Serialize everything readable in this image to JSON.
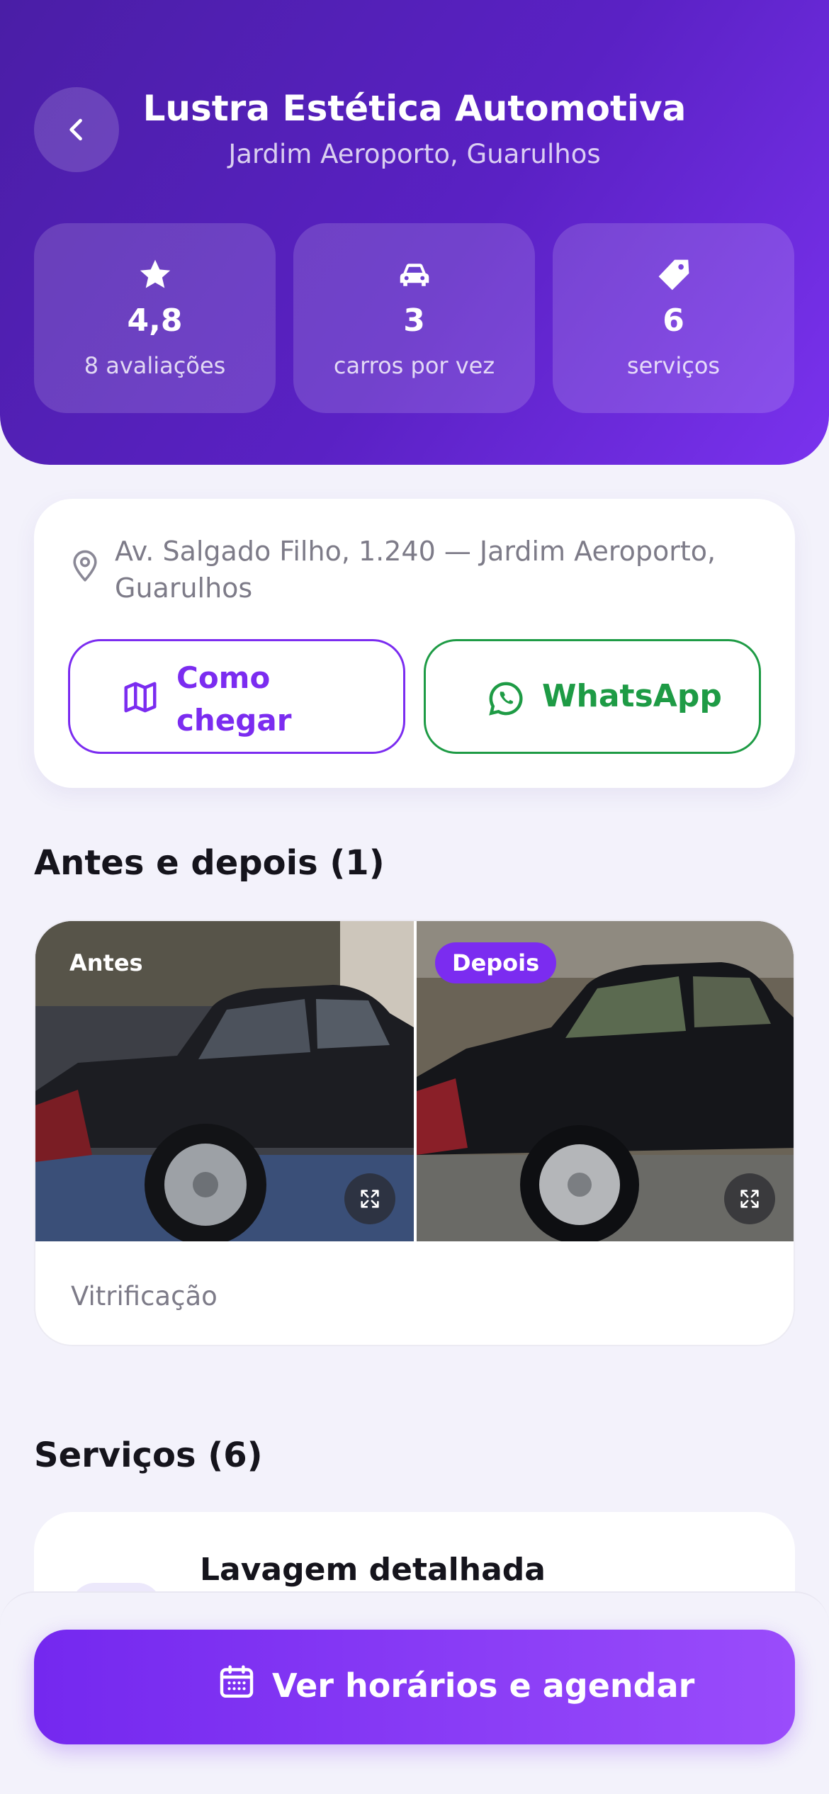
{
  "header": {
    "back_icon": "chevron-left-icon",
    "title": "Lustra Estética Automotiva",
    "subtitle": "Jardim Aeroporto, Guarulhos"
  },
  "stats": [
    {
      "icon": "star-icon",
      "value": "4,8",
      "label": "8 avaliações"
    },
    {
      "icon": "car-icon",
      "value": "3",
      "label": "carros por vez"
    },
    {
      "icon": "tag-icon",
      "value": "6",
      "label": "serviços"
    }
  ],
  "address": {
    "icon": "map-pin-icon",
    "text": "Av. Salgado Filho, 1.240 — Jardim Aeroporto, Guarulhos",
    "route_button": {
      "icon": "map-icon",
      "label": "Como chegar"
    },
    "whatsapp_button": {
      "icon": "whatsapp-icon",
      "label": "WhatsApp"
    }
  },
  "before_after": {
    "title": "Antes e depois (1)",
    "before_tag": "Antes",
    "after_tag": "Depois",
    "expand_icon": "expand-icon",
    "service_label": "Vitrificação"
  },
  "services": {
    "title": "Serviços (6)",
    "items": [
      {
        "name": "Lavagem detalhada"
      }
    ]
  },
  "cta": {
    "icon": "calendar-icon",
    "label": "Ver horários e agendar"
  },
  "colors": {
    "header_gradient_start": "#4a1ea6",
    "header_gradient_end": "#7a32ee",
    "accent_purple": "#7b2cf0",
    "whatsapp_green": "#1e9b45",
    "after_tag": "#7b2cf0"
  }
}
